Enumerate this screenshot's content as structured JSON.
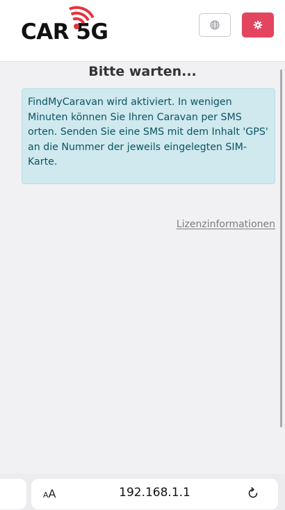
{
  "header": {
    "logo_text": "CAR 5G",
    "language_button_icon": "globe-icon",
    "settings_button_icon": "gear-icon",
    "settings_color": "#e34560"
  },
  "main": {
    "title": "Bitte warten...",
    "alert_text": "FindMyCaravan wird aktiviert. In wenigen Minuten können Sie Ihren Caravan per SMS orten. Senden Sie eine SMS mit dem Inhalt 'GPS' an die Nummer der jeweils eingelegten SIM-Karte.",
    "license_link": "Lizenzinformationen"
  },
  "browser": {
    "text_size_label": "AA",
    "url": "192.168.1.1",
    "reload_icon": "reload-icon"
  },
  "colors": {
    "alert_bg": "#cfe9ee",
    "alert_text": "#0c5363",
    "logo_red": "#e8333c"
  }
}
